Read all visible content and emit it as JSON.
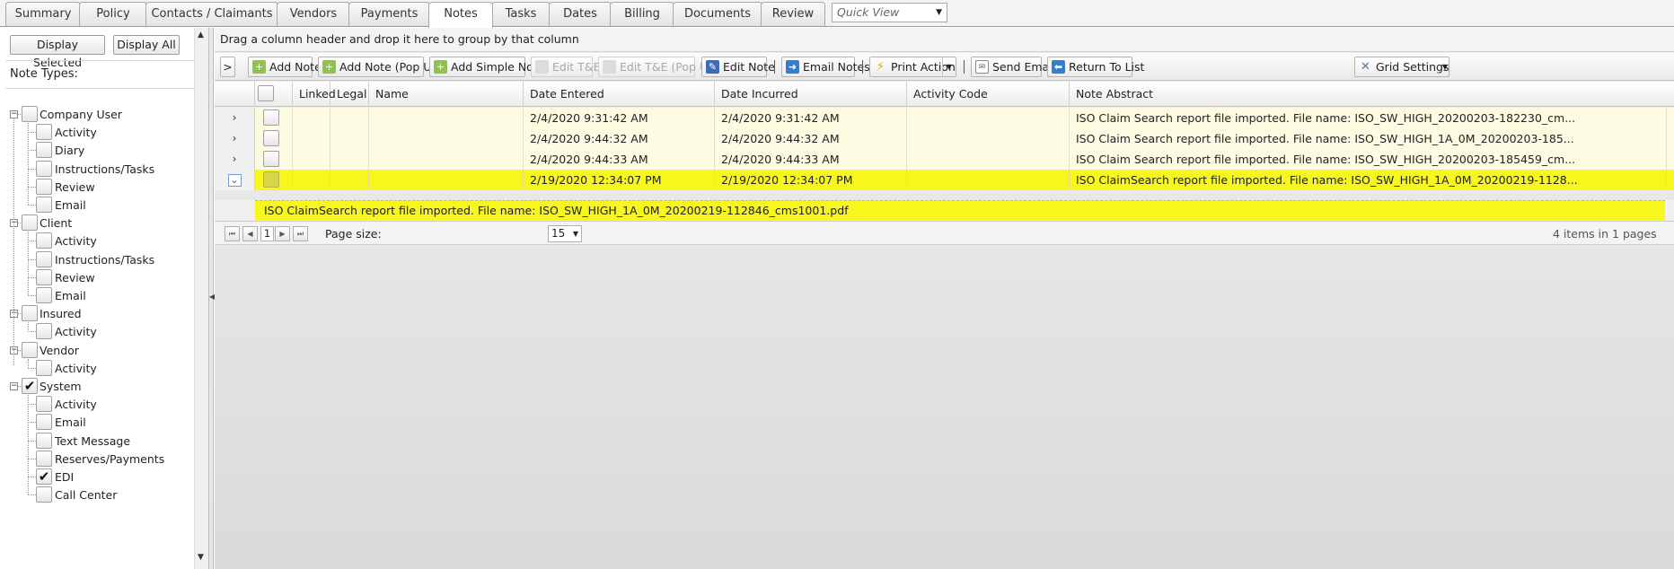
{
  "tabs": [
    {
      "label": "Summary"
    },
    {
      "label": "Policy"
    },
    {
      "label": "Contacts / Claimants"
    },
    {
      "label": "Vendors"
    },
    {
      "label": "Payments"
    },
    {
      "label": "Notes"
    },
    {
      "label": "Tasks"
    },
    {
      "label": "Dates"
    },
    {
      "label": "Billing"
    },
    {
      "label": "Documents"
    },
    {
      "label": "Review"
    }
  ],
  "quick_view": {
    "placeholder": "Quick View"
  },
  "left_panel": {
    "display_selected": "Display Selected",
    "display_all": "Display All",
    "note_types_title": "Note Types:",
    "groups": [
      {
        "label": "Company User",
        "checked": false,
        "children": [
          {
            "label": "Activity",
            "checked": false
          },
          {
            "label": "Diary",
            "checked": false
          },
          {
            "label": "Instructions/Tasks",
            "checked": false
          },
          {
            "label": "Review",
            "checked": false
          },
          {
            "label": "Email",
            "checked": false
          }
        ]
      },
      {
        "label": "Client",
        "checked": false,
        "children": [
          {
            "label": "Activity",
            "checked": false
          },
          {
            "label": "Instructions/Tasks",
            "checked": false
          },
          {
            "label": "Review",
            "checked": false
          },
          {
            "label": "Email",
            "checked": false
          }
        ]
      },
      {
        "label": "Insured",
        "checked": false,
        "children": [
          {
            "label": "Activity",
            "checked": false
          }
        ]
      },
      {
        "label": "Vendor",
        "checked": false,
        "children": [
          {
            "label": "Activity",
            "checked": false
          }
        ]
      },
      {
        "label": "System",
        "checked": true,
        "children": [
          {
            "label": "Activity",
            "checked": false
          },
          {
            "label": "Email",
            "checked": false
          },
          {
            "label": "Text Message",
            "checked": false
          },
          {
            "label": "Reserves/Payments",
            "checked": false
          },
          {
            "label": "EDI",
            "checked": true
          },
          {
            "label": "Call Center",
            "checked": false
          }
        ]
      }
    ]
  },
  "grid": {
    "group_hint": "Drag a column header and drop it here to group by that column",
    "toolbar": {
      "toggle": ">",
      "add_note": "Add Note",
      "add_note_popup": "Add Note (Pop Up)",
      "add_simple_note": "Add Simple Note",
      "edit_te": "Edit T&E",
      "edit_te_popup": "Edit T&E (Pop Up)",
      "edit_note": "Edit Note",
      "email_notes": "Email Notes",
      "print_action": "Print Action",
      "send_email": "Send Email",
      "return_to_list": "Return To List",
      "grid_settings": "Grid Settings"
    },
    "columns": {
      "linked": "Linked",
      "legal": "Legal",
      "name": "Name",
      "date_entered": "Date Entered",
      "date_incurred": "Date Incurred",
      "activity_code": "Activity Code",
      "note_abstract": "Note Abstract"
    },
    "rows": [
      {
        "linked": "",
        "legal": "",
        "name": "",
        "date_entered": "2/4/2020 9:31:42 AM",
        "date_incurred": "2/4/2020 9:31:42 AM",
        "activity_code": "",
        "note_abstract": "ISO Claim Search report file imported. File name: ISO_SW_HIGH_20200203-182230_cm..."
      },
      {
        "linked": "",
        "legal": "",
        "name": "",
        "date_entered": "2/4/2020 9:44:32 AM",
        "date_incurred": "2/4/2020 9:44:32 AM",
        "activity_code": "",
        "note_abstract": "ISO Claim Search report file imported. File name: ISO_SW_HIGH_1A_0M_20200203-185..."
      },
      {
        "linked": "",
        "legal": "",
        "name": "",
        "date_entered": "2/4/2020 9:44:33 AM",
        "date_incurred": "2/4/2020 9:44:33 AM",
        "activity_code": "",
        "note_abstract": "ISO Claim Search report file imported. File name: ISO_SW_HIGH_20200203-185459_cm..."
      },
      {
        "linked": "",
        "legal": "",
        "name": "",
        "date_entered": "2/19/2020 12:34:07 PM",
        "date_incurred": "2/19/2020 12:34:07 PM",
        "activity_code": "",
        "note_abstract": "ISO ClaimSearch report file imported. File name: ISO_SW_HIGH_1A_0M_20200219-1128..."
      }
    ],
    "expanded_detail": "ISO ClaimSearch report file imported. File name: ISO_SW_HIGH_1A_0M_20200219-112846_cms1001.pdf",
    "pager": {
      "current_page": "1",
      "page_size_label": "Page size:",
      "page_size": "15",
      "info": "4 items in 1 pages"
    }
  },
  "colors": {
    "row_bg": "#fdfbe2",
    "selected_row_bg": "#f7f71e"
  }
}
